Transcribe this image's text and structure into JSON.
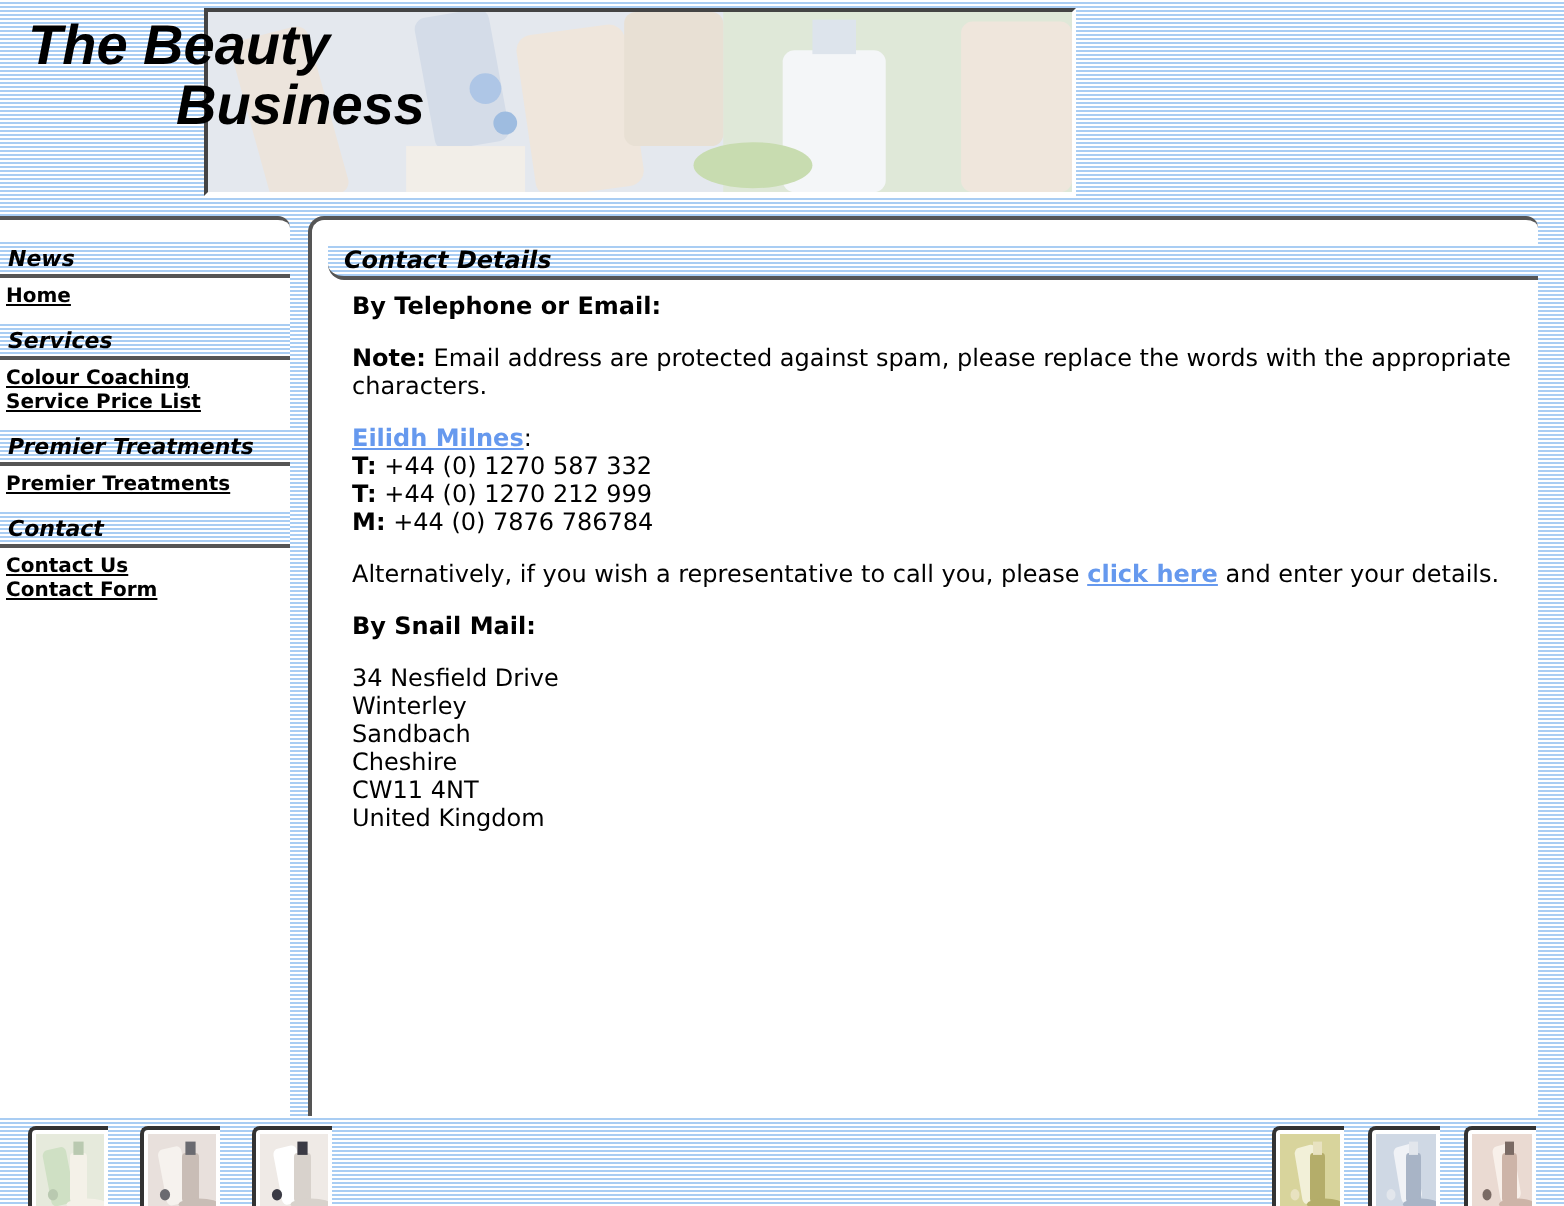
{
  "header": {
    "logo_lines": [
      "The Beauty",
      "Business"
    ],
    "banner": {
      "kind": "picture"
    }
  },
  "sidebar": {
    "sections": [
      {
        "heading": "News",
        "links": [
          "Home"
        ]
      },
      {
        "heading": "Services",
        "links": [
          "Colour Coaching",
          "Service Price List"
        ]
      },
      {
        "heading": "Premier Treatments",
        "links": [
          "Premier Treatments"
        ]
      },
      {
        "heading": "Contact",
        "links": [
          "Contact Us",
          "Contact Form"
        ]
      }
    ]
  },
  "content": {
    "title": "Contact Details",
    "phone_heading": "By Telephone or Email:",
    "note": "**Note:** Email address are protected against spam, please replace the words with the appropriate characters.",
    "contact_name": "Eilidh Milnes",
    "contact_suffix": ":",
    "phones": [
      "**T:** +44 (0) 1270 587 332",
      "**T:** +44 (0) 1270 212 999",
      "**M:** +44 (0) 7876 786784"
    ],
    "callback": {
      "before": "Alternatively, if you wish a representative to call you, please ",
      "link": "click here",
      "after": " and enter your details."
    },
    "mail_heading": "By Snail Mail:",
    "address": [
      "34 Nesfield Drive",
      "Winterley",
      "Sandbach",
      "Cheshire",
      "CW11 4NT",
      "United Kingdom"
    ]
  },
  "footer": {
    "thumbnails_left": [
      {
        "kind": "picture"
      },
      {
        "kind": "picture"
      },
      {
        "kind": "picture"
      }
    ],
    "thumbnails_right": [
      {
        "kind": "picture"
      },
      {
        "kind": "picture"
      },
      {
        "kind": "picture"
      }
    ]
  }
}
